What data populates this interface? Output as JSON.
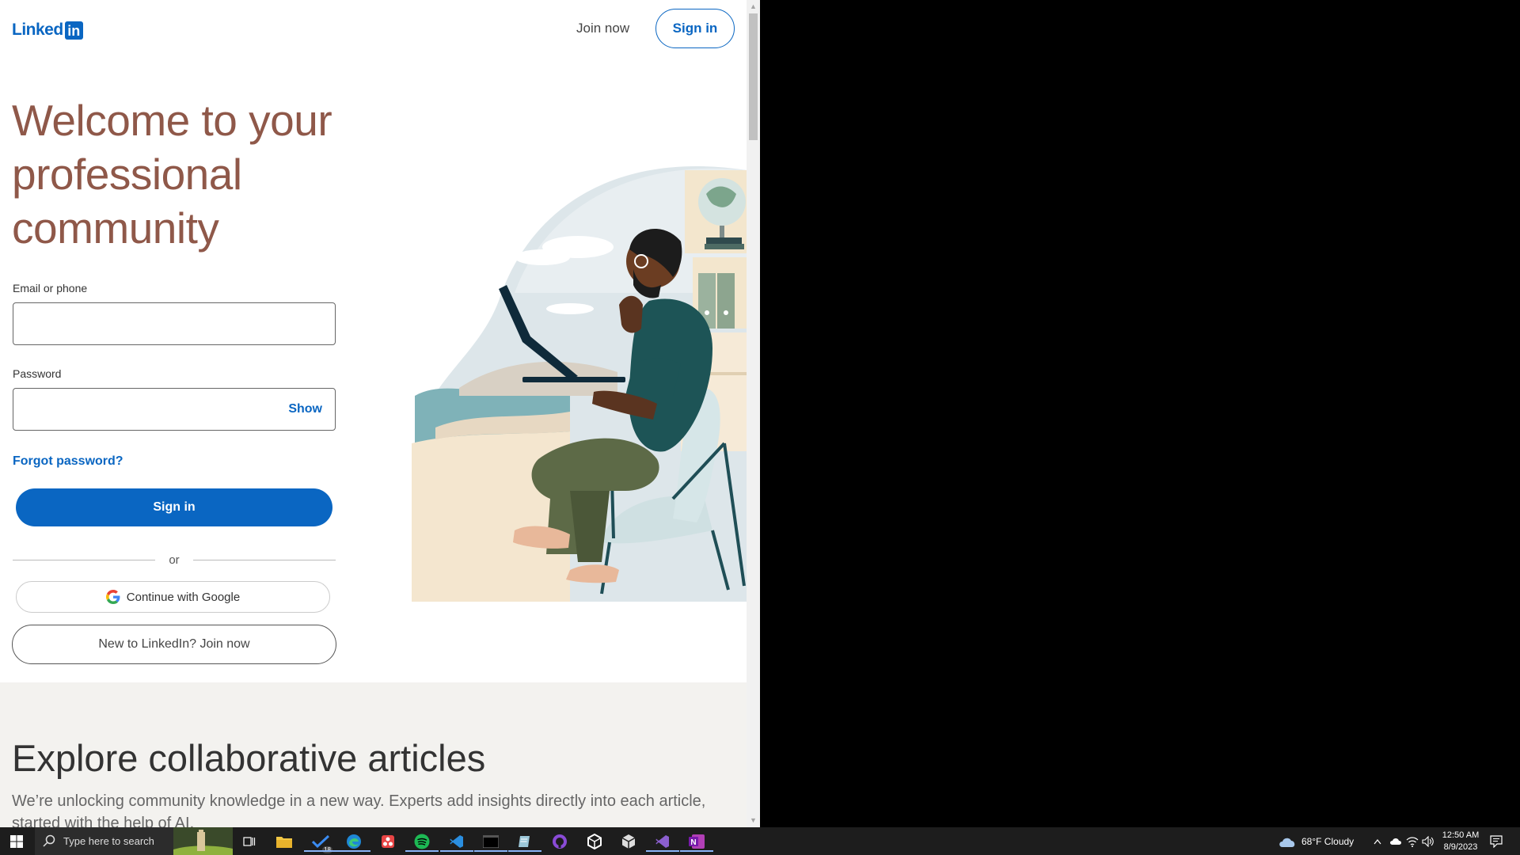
{
  "header": {
    "logo_word": "Linked",
    "logo_box": "in",
    "join_now": "Join now",
    "sign_in": "Sign in"
  },
  "hero": {
    "title_lines": [
      "Welcome to your",
      "professional",
      "community"
    ]
  },
  "form": {
    "email_label": "Email or phone",
    "password_label": "Password",
    "show_label": "Show",
    "forgot_password": "Forgot password?",
    "sign_in_button": "Sign in",
    "or_divider": "or",
    "google_button": "Continue with Google",
    "join_button": "New to LinkedIn? Join now"
  },
  "explore": {
    "heading": "Explore collaborative articles",
    "body": "We’re unlocking community knowledge in a new way. Experts add insights directly into each article, started with the help of AI."
  },
  "taskbar": {
    "search_placeholder": "Type here to search",
    "badge_count": "18",
    "weather": "68°F  Cloudy",
    "time": "12:50 AM",
    "date": "8/9/2023"
  },
  "colors": {
    "brand": "#0a66c2",
    "hero_title": "#8f5849"
  }
}
